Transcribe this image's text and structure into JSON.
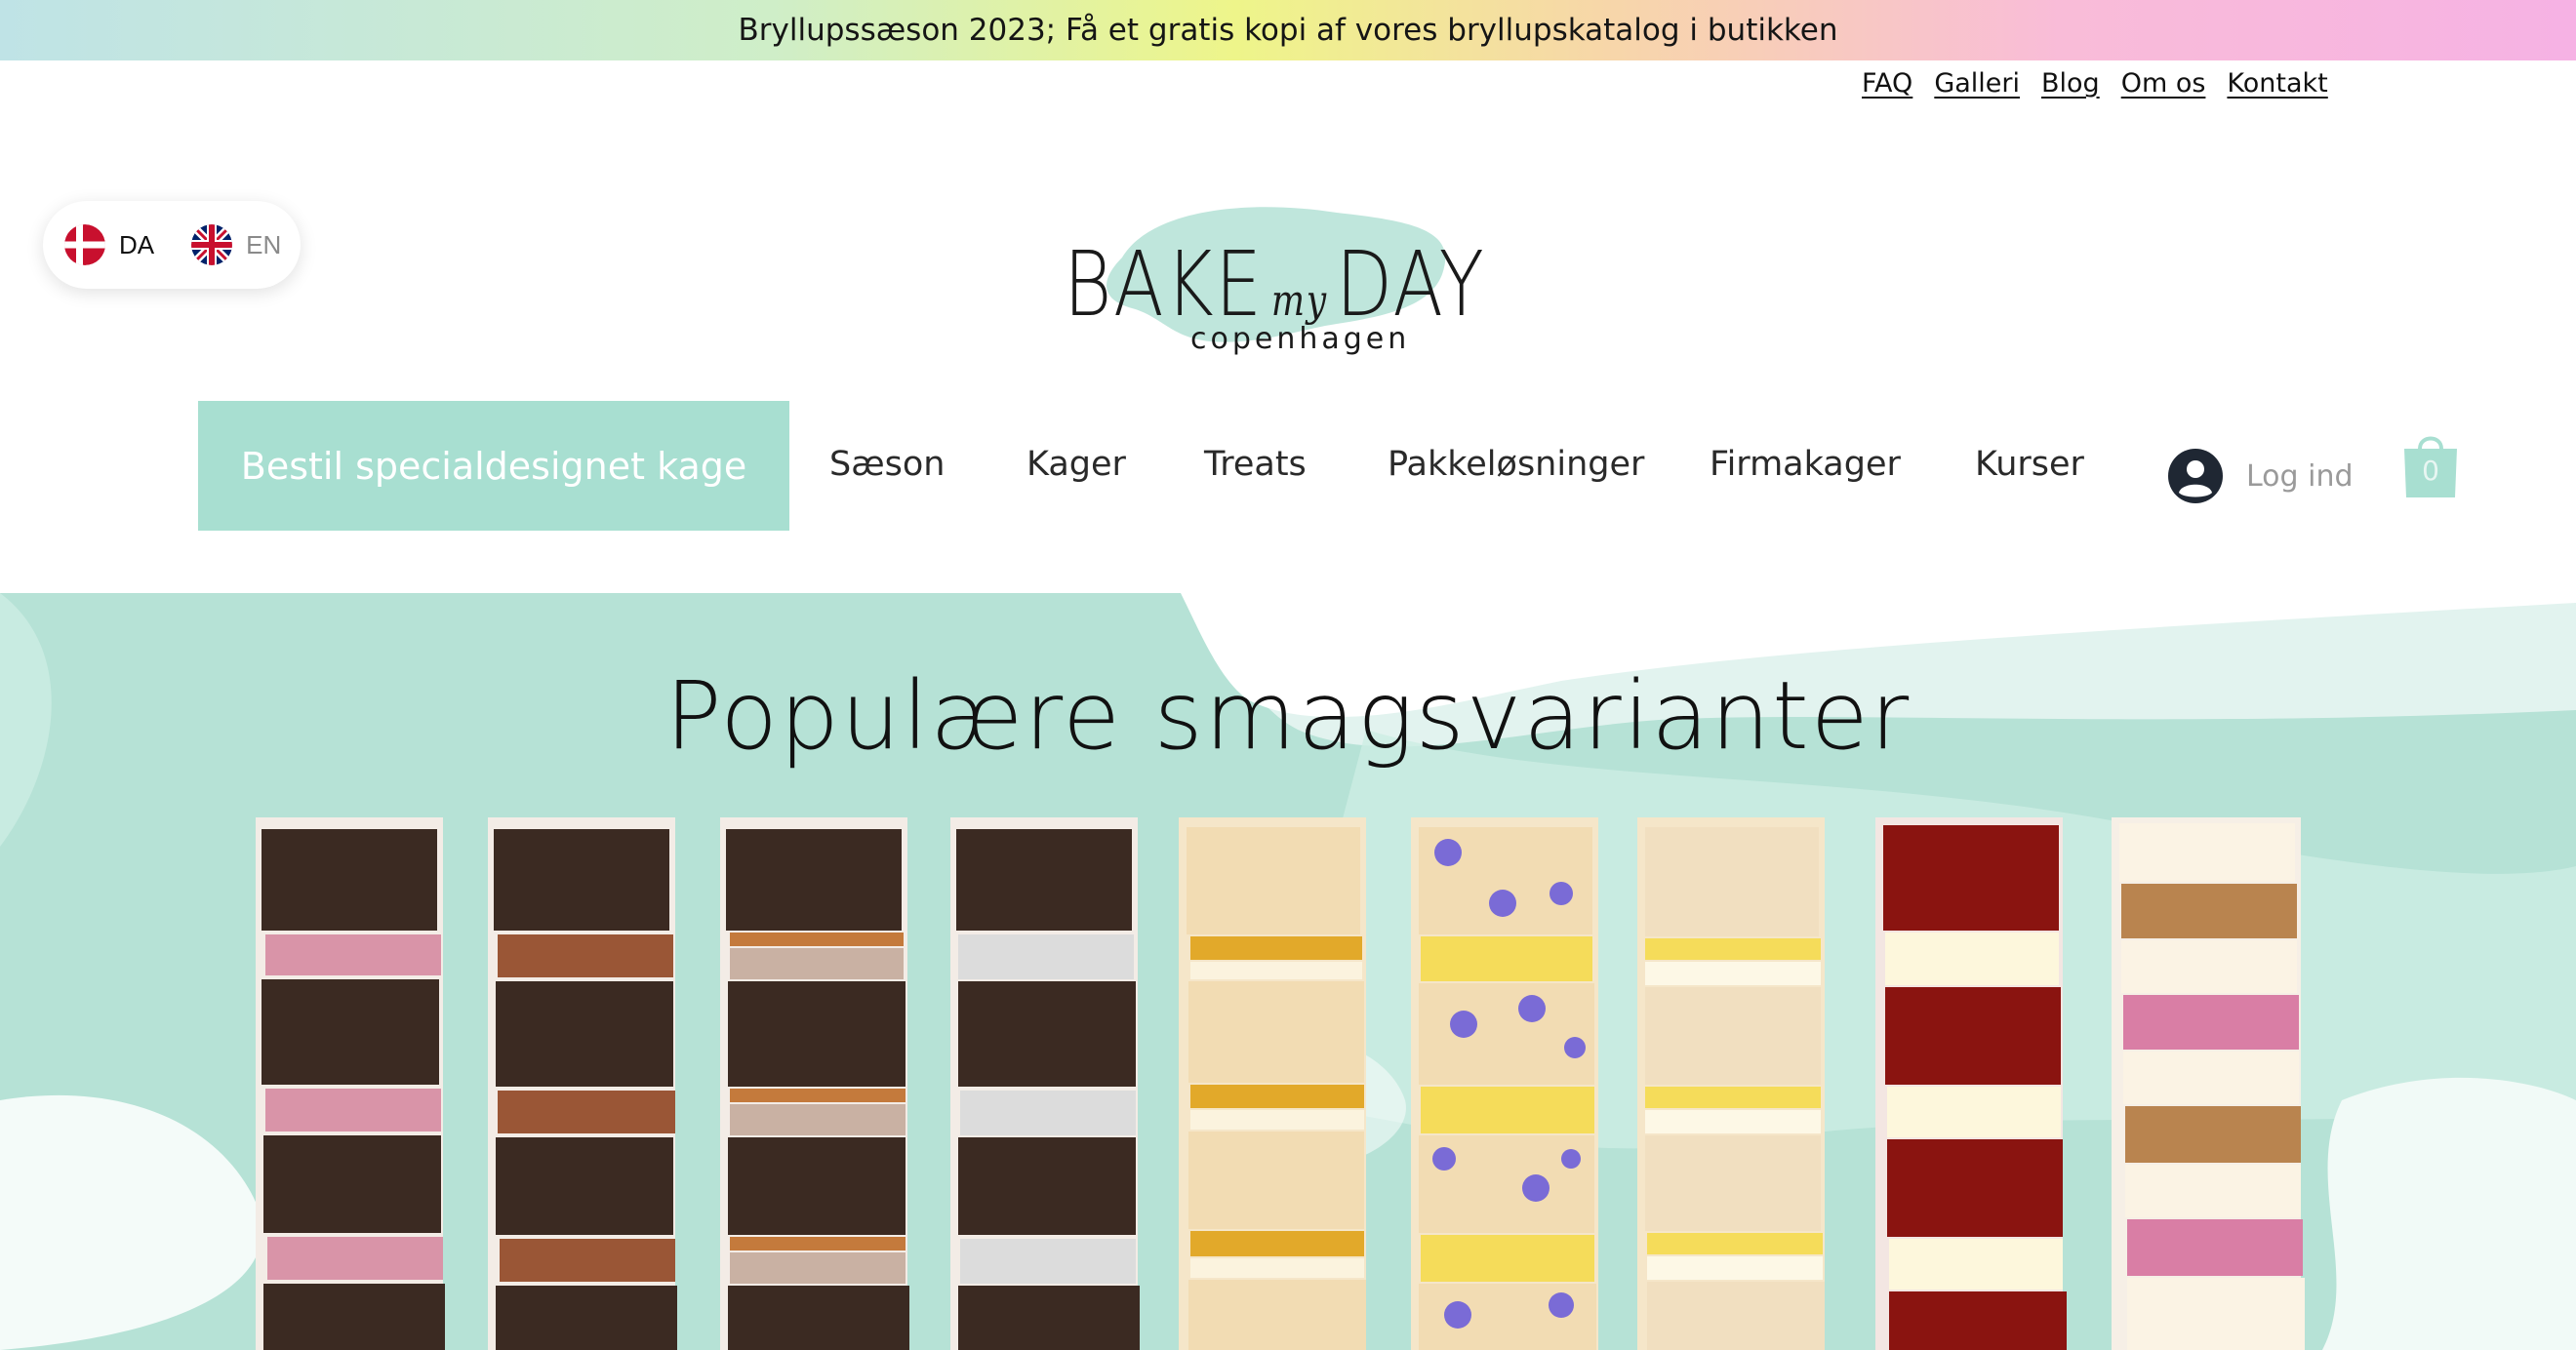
{
  "announcement": "Bryllupssæson 2023; Få et gratis kopi af vores bryllupskatalog i butikken",
  "top_links": [
    "FAQ",
    "Galleri",
    "Blog",
    "Om os",
    "Kontakt"
  ],
  "language": {
    "options": [
      {
        "code": "DA",
        "flag": "denmark-flag-icon",
        "active": true
      },
      {
        "code": "EN",
        "flag": "uk-flag-icon",
        "active": false
      }
    ]
  },
  "logo": {
    "word1": "BAKE",
    "script": "my",
    "word2": "DAY",
    "sub": "copenhagen"
  },
  "nav": {
    "cta": "Bestil specialdesignet kage",
    "items": [
      "Sæson",
      "Kager",
      "Treats",
      "Pakkeløsninger",
      "Firmakager",
      "Kurser"
    ],
    "login": "Log ind",
    "cart_count": "0"
  },
  "hero": {
    "title": "Populære smagsvarianter"
  },
  "colors": {
    "accent": "#a8dfd1",
    "chocolate": "#3b2a22",
    "red_velvet": "#8a1410"
  }
}
